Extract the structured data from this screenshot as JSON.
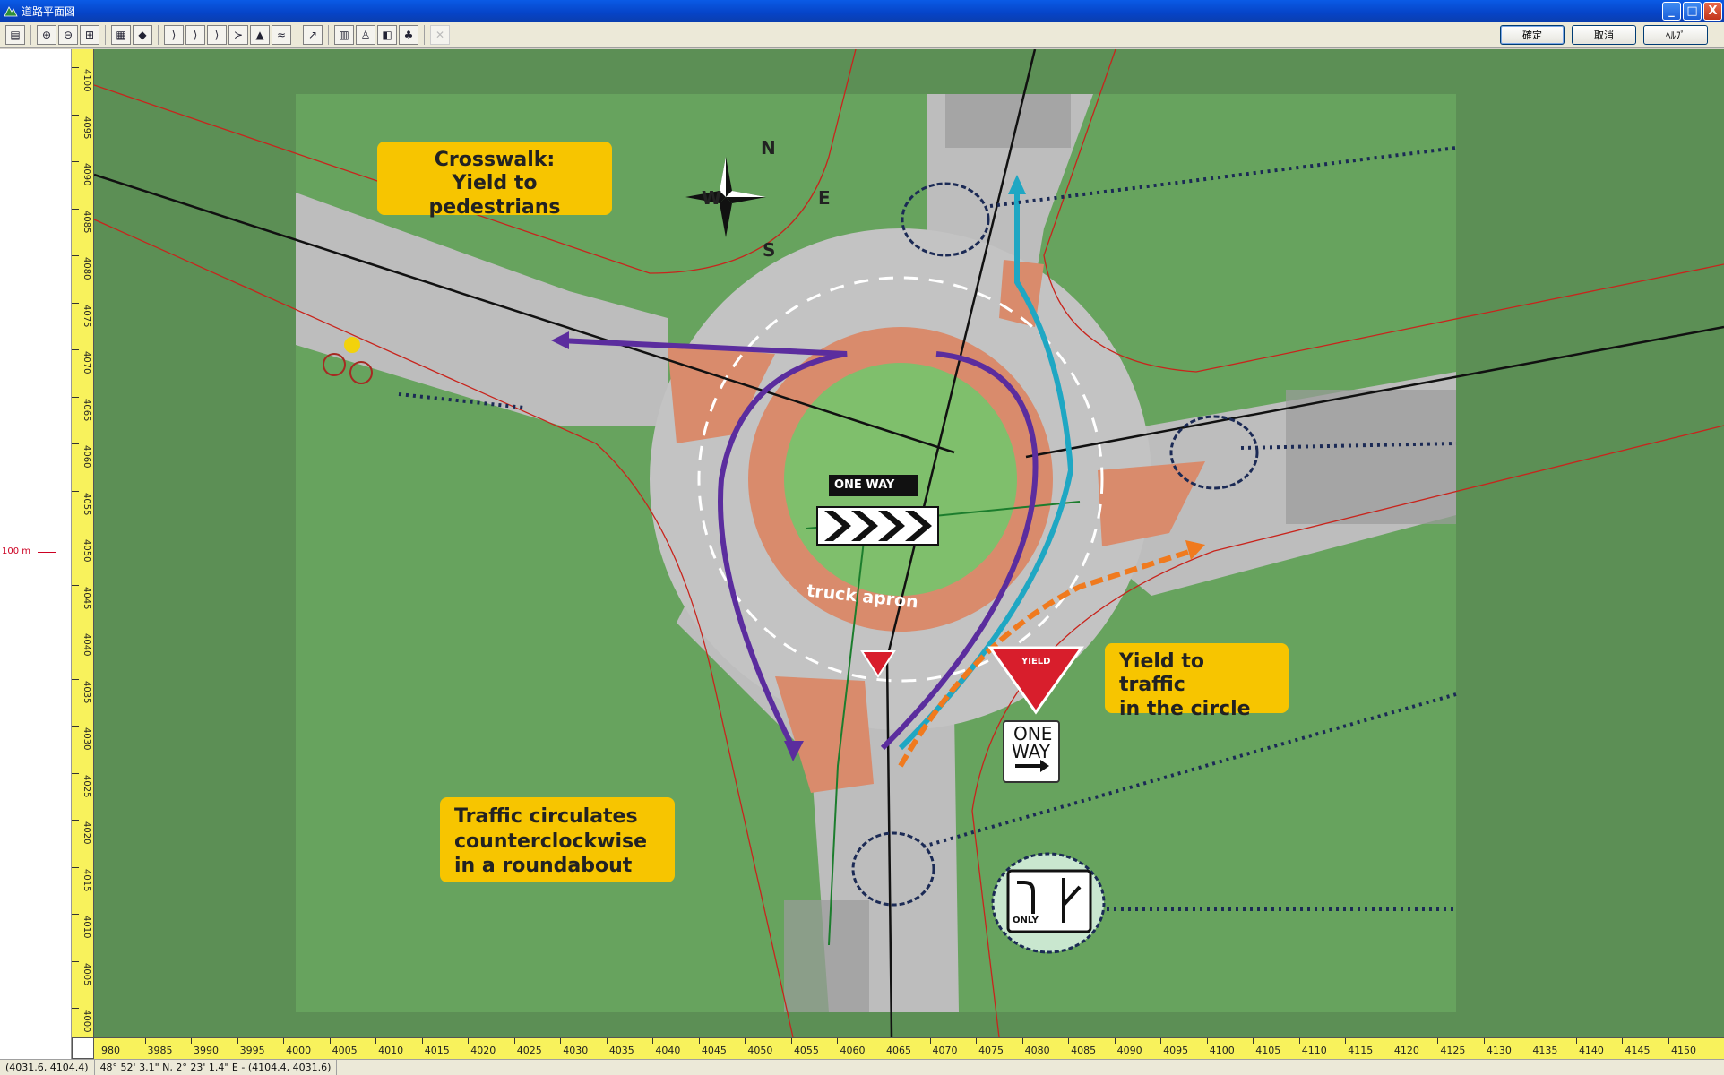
{
  "window": {
    "title": "道路平面図",
    "minimize_label": "_",
    "maximize_label": "□",
    "close_label": "X"
  },
  "toolbar": {
    "tools": [
      {
        "icon": "open-file-icon",
        "glyph": "▤"
      },
      {
        "icon": "zoom-in-icon",
        "glyph": "⊕"
      },
      {
        "icon": "zoom-out-icon",
        "glyph": "⊖"
      },
      {
        "icon": "zoom-extent-icon",
        "glyph": "⊞"
      },
      {
        "icon": "properties-icon",
        "glyph": "▦"
      },
      {
        "icon": "sign-icon",
        "glyph": "◆"
      },
      {
        "icon": "line-tool-1-icon",
        "glyph": "⟩"
      },
      {
        "icon": "line-tool-2-icon",
        "glyph": "⟩"
      },
      {
        "icon": "line-tool-3-icon",
        "glyph": "⟩"
      },
      {
        "icon": "branch-tool-icon",
        "glyph": "≻"
      },
      {
        "icon": "terrain-icon",
        "glyph": "▲"
      },
      {
        "icon": "water-icon",
        "glyph": "≈"
      },
      {
        "icon": "measure-icon",
        "glyph": "↗"
      },
      {
        "icon": "grid-icon",
        "glyph": "▥"
      },
      {
        "icon": "person-icon",
        "glyph": "♙"
      },
      {
        "icon": "layer-icon",
        "glyph": "◧"
      },
      {
        "icon": "tree-icon",
        "glyph": "♣"
      },
      {
        "icon": "delete-icon",
        "glyph": "✕"
      }
    ],
    "confirm_label": "確定",
    "cancel_label": "取消",
    "help_label": "ﾍﾙﾌﾟ"
  },
  "scale": {
    "label": "100 m"
  },
  "ruler": {
    "x_labels": [
      "980",
      "3985",
      "3990",
      "3995",
      "4000",
      "4005",
      "4010",
      "4015",
      "4020",
      "4025",
      "4030",
      "4035",
      "4040",
      "4045",
      "4050",
      "4055",
      "4060",
      "4065",
      "4070",
      "4075",
      "4080",
      "4085",
      "4090",
      "4095",
      "4100",
      "4105",
      "4110",
      "4115",
      "4120",
      "4125",
      "4130",
      "4135",
      "4140",
      "4145",
      "4150"
    ],
    "y_labels": [
      "4100",
      "4095",
      "4090",
      "4085",
      "4080",
      "4075",
      "4070",
      "4065",
      "4060",
      "4055",
      "4050",
      "4045",
      "4040",
      "4035",
      "4030",
      "4025",
      "4020",
      "4015",
      "4010",
      "4005",
      "4000"
    ]
  },
  "map": {
    "compass": {
      "n": "N",
      "s": "S",
      "w": "W",
      "e": "E"
    },
    "callouts": {
      "crosswalk": "Crosswalk:\nYield to pedestrians",
      "yield": "Yield to traffic\nin the circle",
      "circulates": "Traffic circulates\ncounterclockwise\nin a roundabout"
    },
    "signs": {
      "one_way_center": "ONE WAY",
      "yield_sign": "YIELD",
      "one_way_line1": "ONE",
      "one_way_line2": "WAY",
      "lane_only": "ONLY",
      "apron_label": "truck apron"
    }
  },
  "status": {
    "coords": "(4031.6, 4104.4)",
    "geo": "48° 52' 3.1\" N, 2° 23' 1.4\" E - (4104.4, 4031.6)"
  },
  "colors": {
    "titlebar": "#0a5be6",
    "grass": "#5f9a58",
    "road": "#b9b9b9",
    "apron": "#d98b6c",
    "callout": "#f7c500",
    "ruler": "#f8f25c",
    "purple_path": "#5b2d9e",
    "cyan_path": "#1fa7c3",
    "orange_path": "#f07a1e"
  }
}
